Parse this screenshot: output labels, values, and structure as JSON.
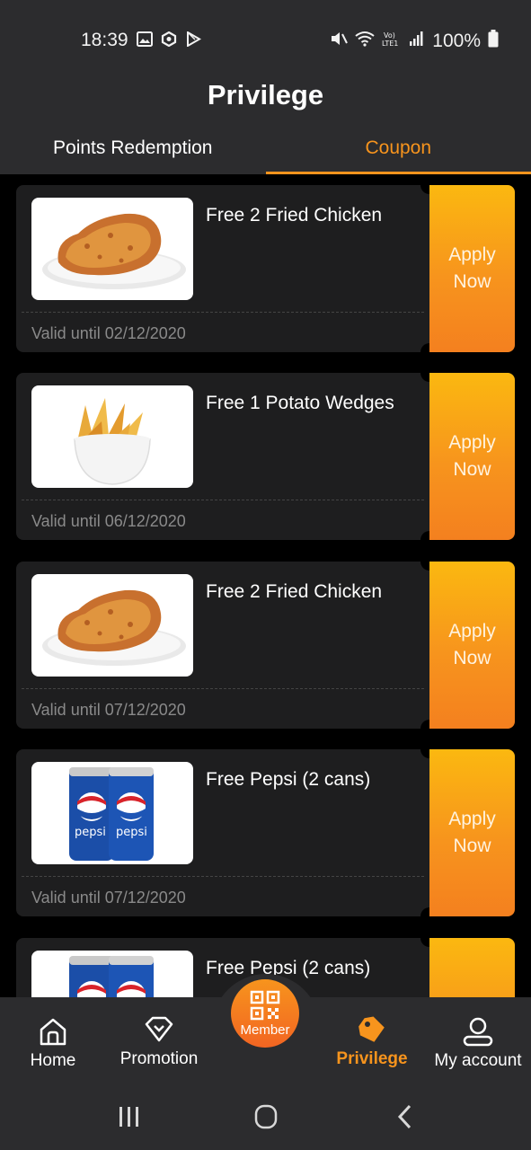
{
  "status": {
    "time": "18:39",
    "battery": "100%"
  },
  "header": {
    "title": "Privilege",
    "tabs": [
      {
        "label": "Points Redemption",
        "active": false
      },
      {
        "label": "Coupon",
        "active": true
      }
    ]
  },
  "coupons": [
    {
      "title": "Free 2 Fried Chicken",
      "valid": "Valid until 02/12/2020",
      "image": "fried-chicken",
      "apply": "Apply Now"
    },
    {
      "title": "Free 1 Potato Wedges",
      "valid": "Valid until 06/12/2020",
      "image": "potato-wedges",
      "apply": "Apply Now"
    },
    {
      "title": "Free 2 Fried Chicken",
      "valid": "Valid until 07/12/2020",
      "image": "fried-chicken",
      "apply": "Apply Now"
    },
    {
      "title": "Free Pepsi (2 cans)",
      "valid": "Valid until 07/12/2020",
      "image": "pepsi-cans",
      "apply": "Apply Now"
    },
    {
      "title": "Free Pepsi (2 cans)",
      "valid": "",
      "image": "pepsi-cans",
      "apply": ""
    }
  ],
  "pepsi_label": "pepsi",
  "bottom_nav": {
    "home": "Home",
    "promotion": "Promotion",
    "member": "Member",
    "privilege": "Privilege",
    "account": "My account"
  },
  "colors": {
    "accent": "#f7941d",
    "panel": "#2c2c2e",
    "card": "#1e1e1f"
  }
}
